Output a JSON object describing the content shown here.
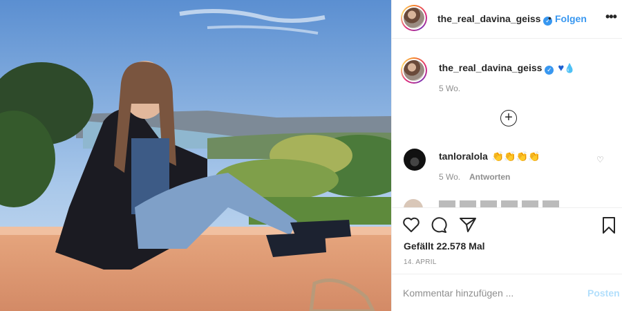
{
  "post": {
    "username": "the_real_davina_geiss",
    "verified_glyph": "✓",
    "dot": "•",
    "follow_label": "Folgen",
    "more_glyph": "•••"
  },
  "caption": {
    "username": "the_real_davina_geiss",
    "emoji_heart": "♥",
    "emoji_drop": "💧",
    "time": "5 Wo."
  },
  "load_more_glyph": "+",
  "comment": {
    "username": "tanloralola",
    "emojis": "👏👏👏👏",
    "time": "5 Wo.",
    "reply_label": "Antworten",
    "like_glyph": "♡"
  },
  "actions": {
    "likes_text": "Gefällt 22.578 Mal",
    "date": "14. APRIL",
    "icons": [
      "heart-icon",
      "comment-icon",
      "share-icon",
      "bookmark-icon"
    ]
  },
  "composer": {
    "placeholder": "Kommentar hinzufügen ...",
    "post_label": "Posten"
  },
  "colors": {
    "accent": "#3897f0",
    "post_disabled": "#b2dffc",
    "muted": "#8e8e8e"
  }
}
